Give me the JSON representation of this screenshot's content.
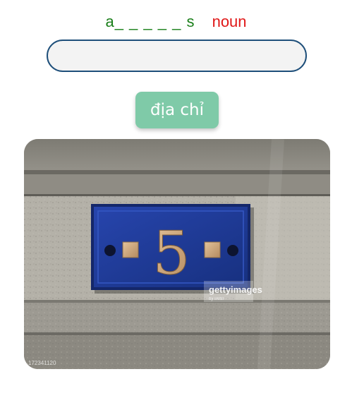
{
  "word_hint": {
    "pattern": "a_ _ _ _ _ s",
    "part_of_speech": "noun"
  },
  "answer_input": {
    "value": "",
    "placeholder": ""
  },
  "hint_button": {
    "label": "địa chỉ",
    "color": "#7fcaa8"
  },
  "image": {
    "plaque_number": "5",
    "watermark": "gettyimages",
    "watermark_credit": "by IAISI",
    "corner_id": "172341120",
    "plaque_color": "#1f3b9a"
  }
}
